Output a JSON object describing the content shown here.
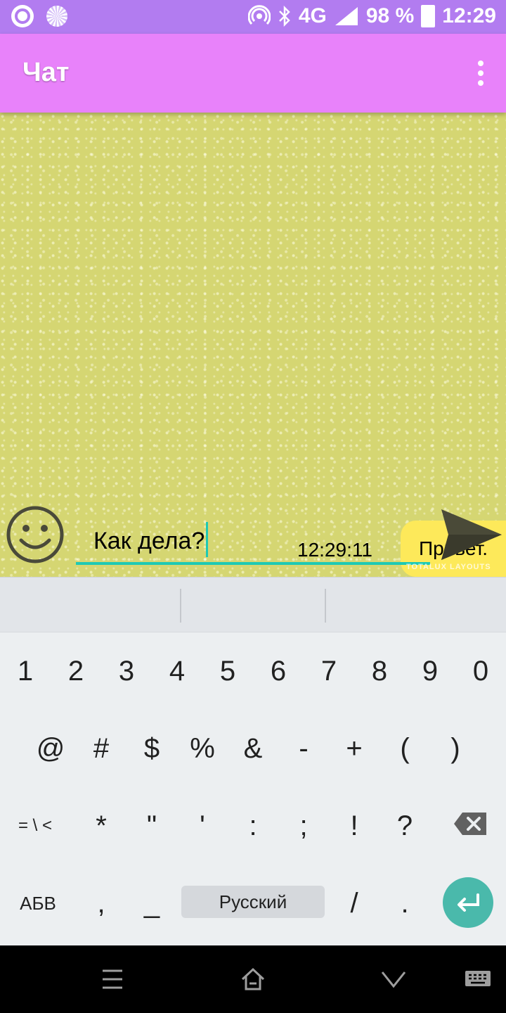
{
  "status_bar": {
    "network": "4G",
    "network_small": "4G",
    "battery": "98 %",
    "time": "12:29"
  },
  "app_bar": {
    "title": "Чат"
  },
  "chat": {
    "messages": [
      {
        "time": "12:29:11",
        "text": "Привет."
      }
    ]
  },
  "composer": {
    "input_value": "Как дела?",
    "watermark": "TOTALUX LAYOUTS"
  },
  "keyboard": {
    "row1": [
      "1",
      "2",
      "3",
      "4",
      "5",
      "6",
      "7",
      "8",
      "9",
      "0"
    ],
    "row2": [
      "@",
      "#",
      "$",
      "%",
      "&",
      "-",
      "+",
      "(",
      ")"
    ],
    "row3": [
      "= \\ <",
      "*",
      "\"",
      "'",
      ":",
      ";",
      "!",
      "?"
    ],
    "row4": {
      "abc": "АБВ",
      "comma": ",",
      "underscore": "_",
      "space": "Русский",
      "slash": "/",
      "period": "."
    }
  },
  "colors": {
    "status_bar": "#b27cf0",
    "app_bar": "#e882fa",
    "bubble": "#fde95a",
    "accent": "#1ec9b4",
    "enter": "#4ab9ab"
  }
}
